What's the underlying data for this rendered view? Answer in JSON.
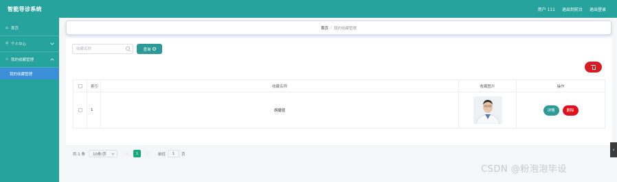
{
  "app": {
    "title": "智能导诊系统",
    "user_label": "用户 111",
    "back_label": "退出到前台",
    "logout_label": "退出登录",
    "brand_color": "#27a39d"
  },
  "sidebar": {
    "items": [
      {
        "label": "首页",
        "icon": "home-icon"
      },
      {
        "label": "个人中心",
        "icon": "user-icon"
      },
      {
        "label": "我的收藏管理",
        "icon": "star-icon"
      }
    ],
    "subitem": "我的收藏管理"
  },
  "breadcrumb": {
    "home": "首页",
    "separator": "/",
    "current": "我的收藏管理"
  },
  "search": {
    "placeholder": "收藏名称",
    "value": "",
    "button": "查询"
  },
  "table": {
    "columns": [
      "索引",
      "收藏名称",
      "收藏图片",
      "操作"
    ],
    "rows": [
      {
        "index": "1",
        "name": "胡捷就",
        "actions": [
          "详情",
          "删除"
        ]
      }
    ]
  },
  "pagination": {
    "total": "共 1 条",
    "page_size": "10条/页",
    "current_page": "1",
    "goto_label": "前往",
    "goto_value": "1",
    "page_unit": "页"
  },
  "watermark": "CSDN @粉泡泡毕设"
}
